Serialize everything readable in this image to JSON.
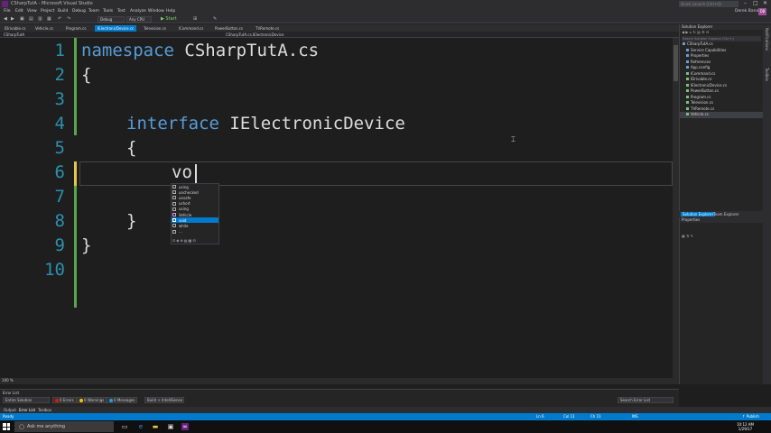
{
  "window": {
    "title": "CSharpTutA - Microsoft Visual Studio",
    "quick_launch": "Quick Launch (Ctrl+Q)",
    "user": "Derek Banas",
    "user_initials": "DB"
  },
  "menu": [
    "File",
    "Edit",
    "View",
    "Project",
    "Build",
    "Debug",
    "Team",
    "Tools",
    "Test",
    "Analyze",
    "Window",
    "Help"
  ],
  "toolbar": {
    "config": "Debug",
    "platform": "Any CPU",
    "start": "▶ Start"
  },
  "tabs": [
    "IDrivable.cs",
    "Vehicle.cs",
    "Program.cs",
    "IElectronicDevice.cs",
    "Television.cs",
    "ICommand.cs",
    "PowerButton.cs",
    "TVRemote.cs"
  ],
  "navbar": {
    "project": "CSharpTutA",
    "scope": "CSharpTutA.cs.IElectronicDevice"
  },
  "editor": {
    "line_numbers": [
      "1",
      "2",
      "3",
      "4",
      "5",
      "6",
      "7",
      "8",
      "9",
      "10"
    ],
    "lines": {
      "l1_kw": "namespace",
      "l1_name": " CSharpTutA.cs",
      "l2": "{",
      "l4_kw": "interface",
      "l4_name": " IElectronicDevice",
      "l5": "{",
      "l6": "vo",
      "l8": "}",
      "l9": "}"
    },
    "zoom": "100 %"
  },
  "intellisense": {
    "items": [
      "using",
      "unchecked",
      "unsafe",
      "ushort",
      "using",
      "Vehicle",
      "void",
      "while",
      "…"
    ],
    "selected_index": 6
  },
  "solution_explorer": {
    "title": "Solution Explorer",
    "search_placeholder": "Search Solution Explorer (Ctrl+;)",
    "items": [
      "CSharpTutA.cs",
      "Service Capabilities",
      "Properties",
      "References",
      "App.config",
      "ICommand.cs",
      "IDrivable.cs",
      "IElectronicDevice.cs",
      "PowerButton.cs",
      "Program.cs",
      "Television.cs",
      "TVRemote.cs",
      "Vehicle.cs"
    ],
    "tab_solution": "Solution Explorer",
    "tab_team": "Team Explorer"
  },
  "properties": {
    "title": "Properties"
  },
  "side_rail": [
    "Notifications",
    "Toolbox"
  ],
  "error_list": {
    "title": "Error List",
    "scope": "Entire Solution",
    "errors": "0 Errors",
    "warnings": "0 Warnings",
    "messages": "0 Messages",
    "build": "Build + IntelliSense",
    "search": "Search Error List"
  },
  "bottom_tabs": [
    "Output",
    "Error List",
    "Toolbox"
  ],
  "status": {
    "ready": "Ready",
    "ln": "Ln 6",
    "col": "Col 11",
    "ch": "Ch 11",
    "ins": "INS",
    "publish": "↑ Publish"
  },
  "taskbar": {
    "search": "Ask me anything",
    "time": "10:12 AM",
    "date": "1/29/17"
  },
  "colors": {
    "accent": "#007acc",
    "keyword": "#569cd6",
    "line_number": "#2b91af",
    "editor_bg": "#1e1e1e"
  }
}
